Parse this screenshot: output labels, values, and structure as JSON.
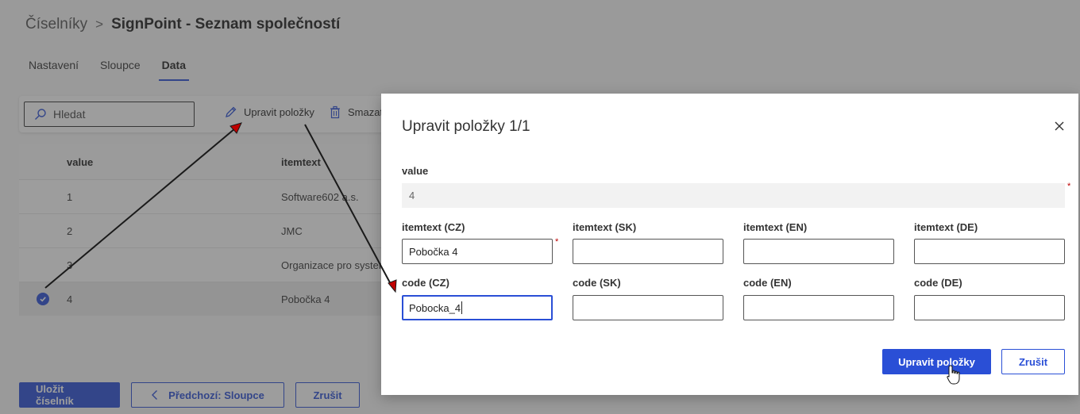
{
  "breadcrumb": {
    "root": "Číselníky",
    "current": "SignPoint - Seznam společností"
  },
  "tabs": [
    {
      "label": "Nastavení"
    },
    {
      "label": "Sloupce"
    },
    {
      "label": "Data"
    }
  ],
  "toolbar": {
    "search_placeholder": "Hledat",
    "edit_label": "Upravit položky",
    "delete_label": "Smazat"
  },
  "table": {
    "columns": [
      "value",
      "itemtext"
    ],
    "rows": [
      {
        "value": "1",
        "itemtext": "Software602 a.s."
      },
      {
        "value": "2",
        "itemtext": "JMC"
      },
      {
        "value": "3",
        "itemtext": "Organizace pro system"
      },
      {
        "value": "4",
        "itemtext": "Pobočka 4"
      }
    ]
  },
  "footer": {
    "save_label": "Uložit číselník",
    "prev_label": "Předchozí: Sloupce",
    "cancel_label": "Zrušit"
  },
  "modal": {
    "title": "Upravit položky 1/1",
    "value_label": "value",
    "value": "4",
    "required_mark": "*",
    "itemtext_labels": [
      "itemtext (CZ)",
      "itemtext (SK)",
      "itemtext (EN)",
      "itemtext (DE)"
    ],
    "itemtext_values": [
      "Pobočka 4",
      "",
      "",
      ""
    ],
    "code_labels": [
      "code (CZ)",
      "code (SK)",
      "code (EN)",
      "code (DE)"
    ],
    "code_values": [
      "Pobocka_4",
      "",
      "",
      ""
    ],
    "submit_label": "Upravit položky",
    "cancel_label": "Zrušit"
  },
  "colors": {
    "accent": "#2a4fd6",
    "required": "#b00000",
    "arrow": "#1a1a1a",
    "arrow_head": "#c00000"
  }
}
